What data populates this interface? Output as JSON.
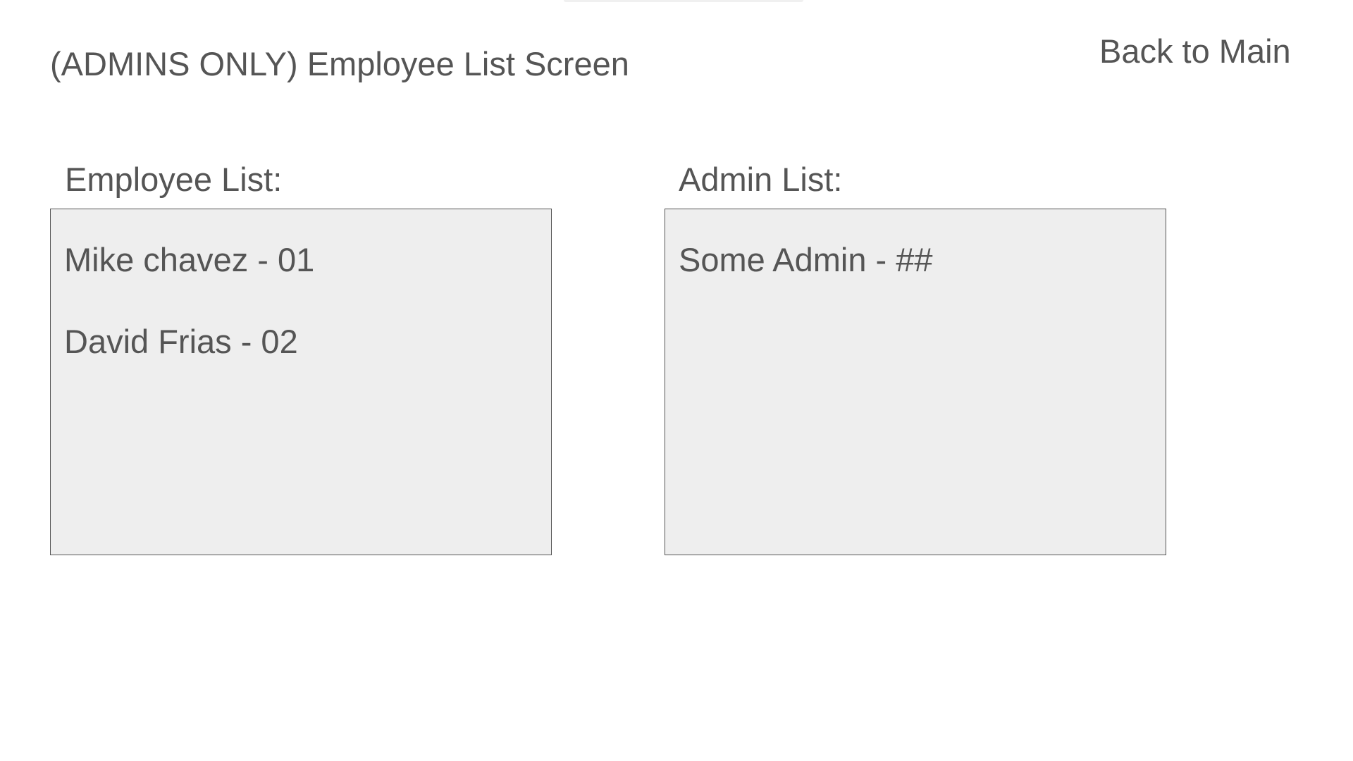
{
  "header": {
    "title": "(ADMINS ONLY) Employee List Screen",
    "back_label": "Back to Main"
  },
  "employee_list": {
    "label": "Employee List:",
    "items": [
      "Mike chavez - 01",
      "David Frias - 02"
    ]
  },
  "admin_list": {
    "label": "Admin List:",
    "items": [
      "Some Admin - ##"
    ]
  }
}
